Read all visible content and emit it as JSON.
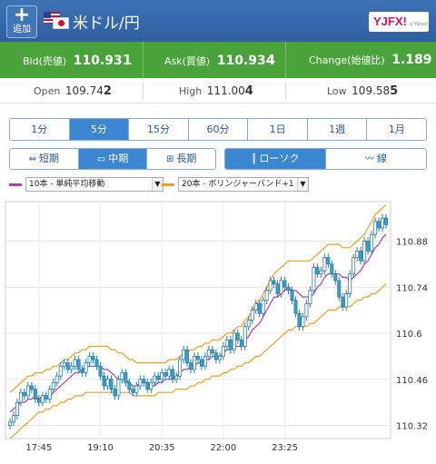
{
  "header": {
    "add_button": {
      "icon": "plus-icon",
      "label": "追加"
    },
    "pair_title": "米ドル/円",
    "logo_text": "YJFX!",
    "logo_subtext": "a Yahoo! company",
    "bg_color": "#3466aa"
  },
  "quotes": {
    "bid": {
      "label": "Bid(売値)",
      "value_main": "110.93",
      "value_tail": "1"
    },
    "ask": {
      "label": "Ask(買値)",
      "value_main": "110.93",
      "value_tail": "4"
    },
    "change": {
      "label": "Change(始値比)",
      "value": "1.189"
    },
    "bar_color": "#4aa33a"
  },
  "ohl": {
    "open": {
      "label": "Open",
      "value_main": "109.74",
      "value_tail": "2"
    },
    "high": {
      "label": "High",
      "value_main": "111.00",
      "value_tail": "4"
    },
    "low": {
      "label": "Low",
      "value_main": "109.58",
      "value_tail": "5"
    }
  },
  "timeframes": {
    "tabs": [
      "1分",
      "5分",
      "15分",
      "60分",
      "1日",
      "1週",
      "1月"
    ],
    "active": "5分"
  },
  "range_buttons": [
    {
      "label": "短期",
      "icon": "short-range-icon",
      "active": false
    },
    {
      "label": "中期",
      "icon": "mid-range-icon",
      "active": true
    },
    {
      "label": "長期",
      "icon": "long-range-icon",
      "active": false
    }
  ],
  "chart_type_buttons": [
    {
      "label": "ローソク",
      "icon": "candlestick-icon",
      "active": true
    },
    {
      "label": "線",
      "icon": "line-chart-icon",
      "active": false
    }
  ],
  "indicators": [
    {
      "label": "10本 - 単純平均移動",
      "color": "#b03cb4"
    },
    {
      "label": "20本 - ボリンジャーバンド+1",
      "color": "#e8a020"
    }
  ],
  "chart_data": {
    "type": "candlestick",
    "y_ticks": [
      110.32,
      110.46,
      110.6,
      110.74,
      110.88
    ],
    "y_tick_labels": [
      "110.32",
      "110.46",
      "110.6",
      "110.74",
      "110.88"
    ],
    "ylim": [
      110.28,
      111.0
    ],
    "x_tick_labels": [
      "17:45",
      "19:10",
      "20:35",
      "22:00",
      "23:25"
    ],
    "grid": true,
    "up_color": "#3aa0c8",
    "down_color": "#3aa0c8",
    "ma_color": "#b03cb4",
    "band_color": "#e8a020",
    "closes": [
      110.33,
      110.35,
      110.39,
      110.42,
      110.41,
      110.44,
      110.43,
      110.4,
      110.39,
      110.41,
      110.4,
      110.43,
      110.45,
      110.47,
      110.5,
      110.51,
      110.49,
      110.5,
      110.52,
      110.49,
      110.48,
      110.51,
      110.53,
      110.52,
      110.5,
      110.47,
      110.44,
      110.46,
      110.43,
      110.41,
      110.46,
      110.48,
      110.45,
      110.43,
      110.42,
      110.44,
      110.46,
      110.45,
      110.43,
      110.45,
      110.47,
      110.46,
      110.48,
      110.47,
      110.49,
      110.46,
      110.47,
      110.52,
      110.55,
      110.51,
      110.49,
      110.53,
      110.52,
      110.5,
      110.53,
      110.55,
      110.54,
      110.52,
      110.53,
      110.56,
      110.58,
      110.55,
      110.6,
      110.58,
      110.56,
      110.62,
      110.64,
      110.67,
      110.69,
      110.66,
      110.7,
      110.73,
      110.76,
      110.75,
      110.72,
      110.76,
      110.74,
      110.73,
      110.7,
      110.66,
      110.62,
      110.65,
      110.69,
      110.73,
      110.8,
      110.78,
      110.79,
      110.83,
      110.81,
      110.78,
      110.76,
      110.71,
      110.68,
      110.72,
      110.78,
      110.83,
      110.85,
      110.82,
      110.88,
      110.85,
      110.9,
      110.94,
      110.92,
      110.95,
      110.93
    ],
    "ma10": [
      110.36,
      110.37,
      110.38,
      110.39,
      110.39,
      110.4,
      110.4,
      110.41,
      110.4,
      110.41,
      110.41,
      110.41,
      110.42,
      110.43,
      110.44,
      110.45,
      110.46,
      110.47,
      110.48,
      110.48,
      110.49,
      110.5,
      110.5,
      110.5,
      110.5,
      110.5,
      110.49,
      110.49,
      110.48,
      110.47,
      110.46,
      110.46,
      110.46,
      110.45,
      110.44,
      110.44,
      110.45,
      110.45,
      110.45,
      110.44,
      110.44,
      110.45,
      110.45,
      110.46,
      110.46,
      110.46,
      110.47,
      110.48,
      110.49,
      110.49,
      110.5,
      110.5,
      110.51,
      110.51,
      110.52,
      110.52,
      110.53,
      110.53,
      110.53,
      110.54,
      110.55,
      110.55,
      110.56,
      110.56,
      110.56,
      110.58,
      110.59,
      110.61,
      110.62,
      110.63,
      110.65,
      110.67,
      110.69,
      110.71,
      110.71,
      110.72,
      110.73,
      110.74,
      110.73,
      110.73,
      110.72,
      110.71,
      110.71,
      110.71,
      110.72,
      110.74,
      110.75,
      110.77,
      110.78,
      110.78,
      110.78,
      110.78,
      110.77,
      110.77,
      110.76,
      110.77,
      110.78,
      110.79,
      110.81,
      110.82,
      110.84,
      110.86,
      110.87,
      110.89,
      110.9
    ],
    "band_upper": [
      110.42,
      110.43,
      110.44,
      110.45,
      110.46,
      110.47,
      110.47,
      110.48,
      110.48,
      110.48,
      110.49,
      110.49,
      110.5,
      110.5,
      110.51,
      110.52,
      110.52,
      110.53,
      110.54,
      110.54,
      110.55,
      110.55,
      110.56,
      110.56,
      110.56,
      110.56,
      110.56,
      110.56,
      110.55,
      110.55,
      110.54,
      110.54,
      110.53,
      110.52,
      110.52,
      110.51,
      110.51,
      110.51,
      110.51,
      110.51,
      110.51,
      110.51,
      110.51,
      110.51,
      110.52,
      110.52,
      110.52,
      110.53,
      110.54,
      110.54,
      110.55,
      110.55,
      110.56,
      110.56,
      110.57,
      110.57,
      110.58,
      110.58,
      110.58,
      110.59,
      110.6,
      110.6,
      110.61,
      110.62,
      110.62,
      110.64,
      110.65,
      110.67,
      110.69,
      110.7,
      110.72,
      110.74,
      110.76,
      110.78,
      110.79,
      110.8,
      110.81,
      110.82,
      110.82,
      110.82,
      110.82,
      110.82,
      110.82,
      110.82,
      110.83,
      110.84,
      110.85,
      110.86,
      110.87,
      110.87,
      110.87,
      110.87,
      110.86,
      110.86,
      110.86,
      110.87,
      110.88,
      110.89,
      110.9,
      110.92,
      110.94,
      110.96,
      110.97,
      110.98,
      110.99
    ],
    "band_lower": [
      110.28,
      110.29,
      110.3,
      110.31,
      110.32,
      110.33,
      110.34,
      110.35,
      110.36,
      110.36,
      110.37,
      110.37,
      110.38,
      110.38,
      110.39,
      110.39,
      110.4,
      110.4,
      110.41,
      110.41,
      110.41,
      110.42,
      110.42,
      110.42,
      110.42,
      110.42,
      110.42,
      110.42,
      110.42,
      110.42,
      110.42,
      110.42,
      110.42,
      110.42,
      110.41,
      110.41,
      110.41,
      110.41,
      110.41,
      110.41,
      110.41,
      110.42,
      110.42,
      110.42,
      110.42,
      110.42,
      110.43,
      110.43,
      110.43,
      110.43,
      110.44,
      110.44,
      110.45,
      110.45,
      110.46,
      110.46,
      110.47,
      110.47,
      110.47,
      110.48,
      110.48,
      110.49,
      110.49,
      110.5,
      110.5,
      110.51,
      110.51,
      110.52,
      110.53,
      110.53,
      110.54,
      110.55,
      110.56,
      110.57,
      110.58,
      110.59,
      110.6,
      110.61,
      110.61,
      110.62,
      110.62,
      110.62,
      110.62,
      110.63,
      110.63,
      110.64,
      110.65,
      110.66,
      110.67,
      110.67,
      110.67,
      110.68,
      110.68,
      110.68,
      110.68,
      110.69,
      110.7,
      110.7,
      110.71,
      110.71,
      110.72,
      110.72,
      110.73,
      110.74,
      110.75
    ]
  }
}
